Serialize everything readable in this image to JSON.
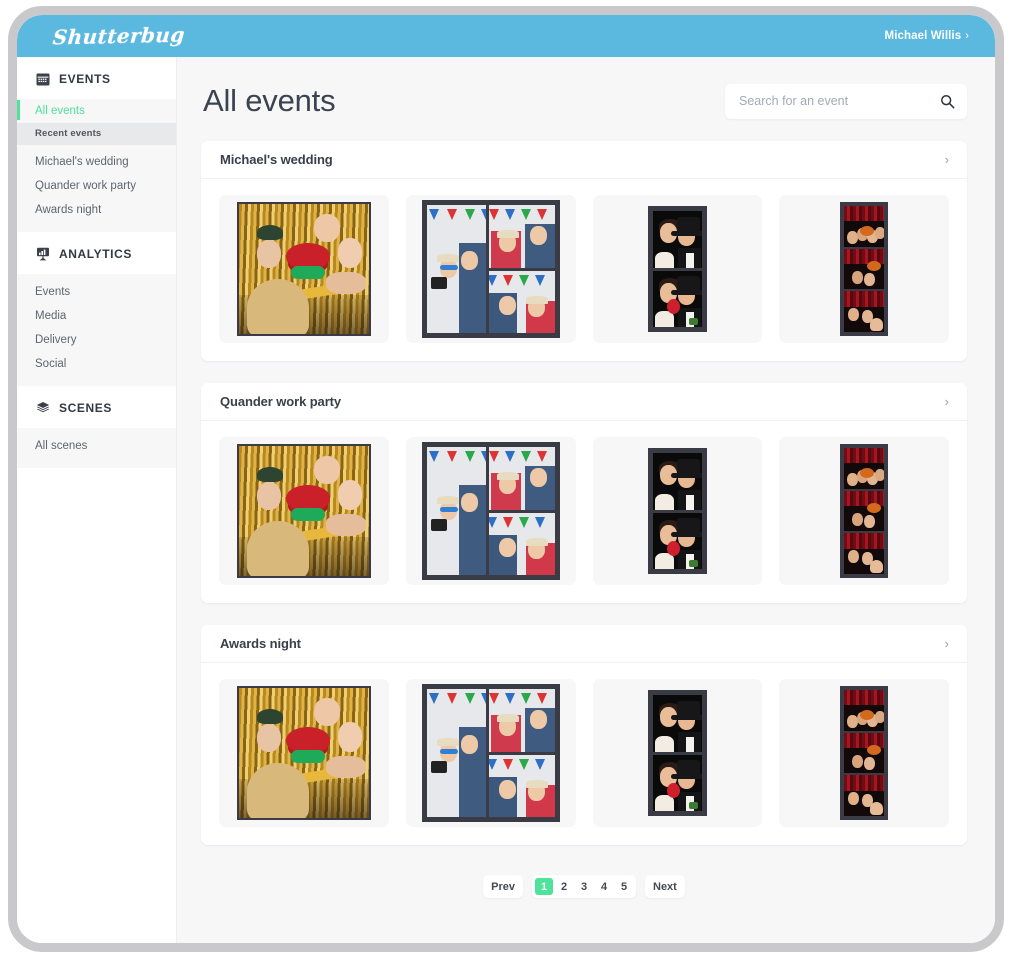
{
  "topbar": {
    "logo": "Shutterbug",
    "user_name": "Michael Willis",
    "user_chevron": "›",
    "bg_color": "#5bb9e0"
  },
  "sidebar": {
    "groups": [
      {
        "icon": "calendar-icon",
        "title": "EVENTS",
        "items": [
          {
            "label": "All events",
            "active": true,
            "type": "link"
          },
          {
            "label": "Recent events",
            "active": false,
            "type": "subhead"
          },
          {
            "label": "Michael's wedding",
            "active": false,
            "type": "link"
          },
          {
            "label": "Quander work party",
            "active": false,
            "type": "link"
          },
          {
            "label": "Awards night",
            "active": false,
            "type": "link"
          }
        ]
      },
      {
        "icon": "analytics-icon",
        "title": "ANALYTICS",
        "items": [
          {
            "label": "Events",
            "active": false,
            "type": "link"
          },
          {
            "label": "Media",
            "active": false,
            "type": "link"
          },
          {
            "label": "Delivery",
            "active": false,
            "type": "link"
          },
          {
            "label": "Social",
            "active": false,
            "type": "link"
          }
        ]
      },
      {
        "icon": "layers-icon",
        "title": "SCENES",
        "items": [
          {
            "label": "All scenes",
            "active": false,
            "type": "link"
          }
        ]
      }
    ],
    "accent_color": "#4ee29b"
  },
  "main": {
    "page_title": "All events",
    "search": {
      "placeholder": "Search for an event",
      "value": "",
      "icon": "search-icon"
    },
    "events": [
      {
        "name": "Michael's wedding",
        "chevron": "›",
        "thumbnails": [
          {
            "kind": "square-group-gold",
            "alt": "Group photo with gold sequin backdrop, red hat and green mask"
          },
          {
            "kind": "collage-bunting",
            "alt": "Three-pane collage with bunting flags and props"
          },
          {
            "kind": "strip-2up-black",
            "alt": "Two-frame photo strip, couple with black top hat"
          },
          {
            "kind": "strip-3up-red",
            "alt": "Three-frame photo strip with red curtain backdrop"
          }
        ]
      },
      {
        "name": "Quander work party",
        "chevron": "›",
        "thumbnails": [
          {
            "kind": "square-group-gold",
            "alt": "Group photo with gold sequin backdrop, red hat and green mask"
          },
          {
            "kind": "collage-bunting",
            "alt": "Three-pane collage with bunting flags and props"
          },
          {
            "kind": "strip-2up-black",
            "alt": "Two-frame photo strip, couple with black top hat"
          },
          {
            "kind": "strip-3up-red",
            "alt": "Three-frame photo strip with red curtain backdrop"
          }
        ]
      },
      {
        "name": "Awards night",
        "chevron": "›",
        "thumbnails": [
          {
            "kind": "square-group-gold",
            "alt": "Group photo with gold sequin backdrop, red hat and green mask"
          },
          {
            "kind": "collage-bunting",
            "alt": "Three-pane collage with bunting flags and props"
          },
          {
            "kind": "strip-2up-black",
            "alt": "Two-frame photo strip, couple with black top hat"
          },
          {
            "kind": "strip-3up-red",
            "alt": "Three-frame photo strip with red curtain backdrop"
          }
        ]
      }
    ],
    "pagination": {
      "prev_label": "Prev",
      "next_label": "Next",
      "pages": [
        "1",
        "2",
        "3",
        "4",
        "5"
      ],
      "current_page": "1",
      "active_color": "#4ee29b"
    }
  }
}
